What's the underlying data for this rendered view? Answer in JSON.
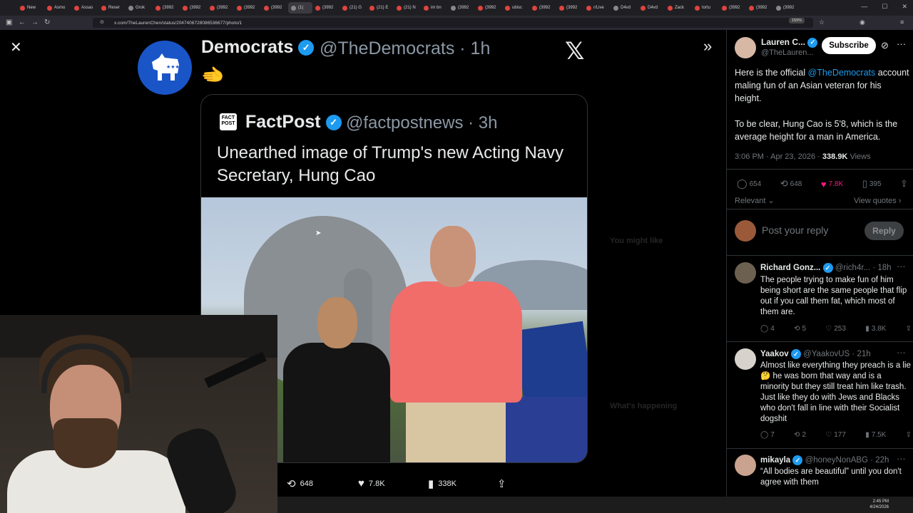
{
  "browser": {
    "url": "x.com/TheLaurenChen/status/2047406728086536677/photo/1",
    "zoom": "150%",
    "tabs": [
      "New",
      "Asmo",
      "Assas",
      "Reser",
      "Grok",
      "(3992",
      "(3992",
      "(3992",
      "(3992",
      "(3992",
      "(1(",
      "(3992",
      "(21) G",
      "(21) E",
      "(21) N",
      "im bn",
      "(3992",
      "(3992",
      "ubisc",
      "(3992",
      "(3992",
      "r/Live",
      "D4vd",
      "D4vd",
      "Zack",
      "tortu",
      "(3992",
      "(3992",
      "(3992"
    ]
  },
  "tweet": {
    "author_name": "Democrats",
    "author_handle": "@TheDemocrats",
    "time": "· 1h",
    "text": "🫲",
    "quote": {
      "author_name": "FactPost",
      "author_handle": "@factpostnews",
      "time": "· 3h",
      "logo_text": "FACT POST",
      "text": "Unearthed image of Trump's new Acting Navy Secretary, Hung Cao"
    },
    "stats": {
      "retweets": "648",
      "likes": "7.8K",
      "views": "338K"
    }
  },
  "panel": {
    "author_name": "Lauren C...",
    "author_handle": "@TheLauren...",
    "subscribe_label": "Subscribe",
    "text_1a": "Here is the official ",
    "mention": "@TheDemocrats",
    "text_1b": " account maling fun of an Asian veteran for his height.",
    "text_2": "To be clear, Hung Cao is 5'8, which is the average height for a man in America.",
    "timestamp": "3:06 PM · Apr 23, 2026 · ",
    "views_count": "338.9K",
    "views_label": " Views",
    "stats": {
      "replies": "654",
      "retweets": "648",
      "likes": "7.8K",
      "bookmarks": "395"
    },
    "sort_label": "Relevant",
    "view_quotes": "View quotes",
    "reply_placeholder": "Post your reply",
    "reply_button": "Reply",
    "replies": [
      {
        "name": "Richard Gonz...",
        "handle": "@rich4r...",
        "time": "· 18h",
        "text": "The people trying to make fun of him being short are the same people that flip out if you call them fat, which most of them are.",
        "replies": "4",
        "retweets": "5",
        "likes": "253",
        "views": "3.8K"
      },
      {
        "name": "Yaakov",
        "handle": "@YaakovUS",
        "time": "· 21h",
        "text": "Almost like everything they preach is a lie 🤔 he was born that way and is a minority but they still treat him like trash. Just like they do with Jews and Blacks who don't fall in line with their Socialist dogshit",
        "replies": "7",
        "retweets": "2",
        "likes": "177",
        "views": "7.5K"
      },
      {
        "name": "mikayla",
        "handle": "@honeyNonABG",
        "time": "· 22h",
        "text": "“All bodies are beautiful” until you don't agree with them"
      }
    ]
  },
  "background": {
    "you_might_like": "You might like",
    "whats_happening": "What's happening"
  },
  "taskbar": {
    "time": "2:45 PM",
    "date": "4/24/2026"
  }
}
